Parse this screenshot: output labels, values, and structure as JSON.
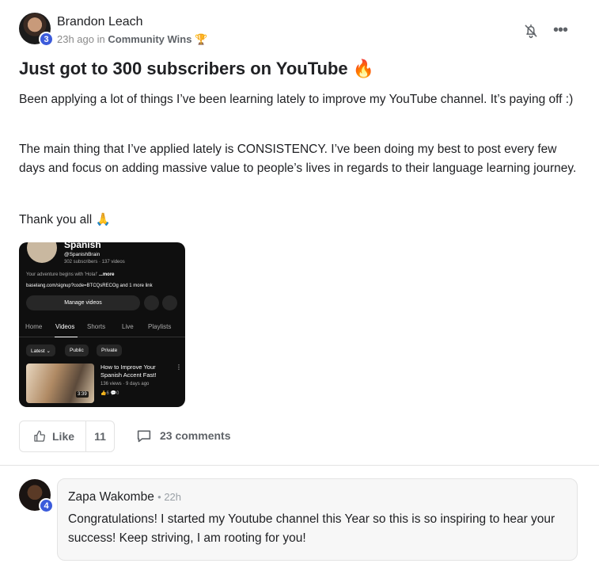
{
  "post": {
    "author": {
      "name": "Brandon Leach",
      "level": "3"
    },
    "meta": {
      "time": "23h ago",
      "in_word": "in",
      "category": "Community Wins",
      "category_emoji": "🏆"
    },
    "title": "Just got to 300 subscribers on YouTube",
    "title_emoji": "🔥",
    "paragraphs": [
      "Been applying a lot of things I’ve been learning lately to improve my YouTube channel. It’s paying off :)",
      "The main thing that I’ve applied lately is CONSISTENCY. I’ve been doing my best to post every few days and focus on adding massive value to people’s lives in regards to their language learning journey.",
      "Thank you all 🙏"
    ],
    "actions": {
      "like_label": "Like",
      "like_count": "11",
      "comments_label": "23 comments"
    }
  },
  "screenshot": {
    "channel_name": "Spanish",
    "handle": "@SpanishBrain",
    "stats": "302 subscribers · 137 videos",
    "description": "Your adventure begins with 'Hola!'",
    "description_more": "...more",
    "link": "baselang.com/signup?code=BTCQsRECOg and 1 more link",
    "manage_label": "Manage videos",
    "tabs": [
      "Home",
      "Videos",
      "Shorts",
      "Live",
      "Playlists"
    ],
    "active_tab": "Videos",
    "chips": [
      "Latest ⌄",
      "Public",
      "Private"
    ],
    "video": {
      "title": "How to Improve Your Spanish Accent Fast!",
      "meta": "136 views · 9 days ago",
      "stats": "👍6  💬0",
      "duration": "3:39"
    }
  },
  "comment": {
    "author": "Zapa Wakombe",
    "level": "4",
    "time": "• 22h",
    "text": "Congratulations! I started my Youtube channel this Year so this is so inspiring to hear your success! Keep striving, I am rooting for you!"
  },
  "colors": {
    "accent": "#3b5bdb",
    "muted": "#5f6368",
    "border": "#e3e3e3",
    "bubble": "#f7f7f7"
  },
  "icons": [
    "bell-off-icon",
    "more-horizontal-icon",
    "thumbs-up-icon",
    "comment-icon"
  ]
}
